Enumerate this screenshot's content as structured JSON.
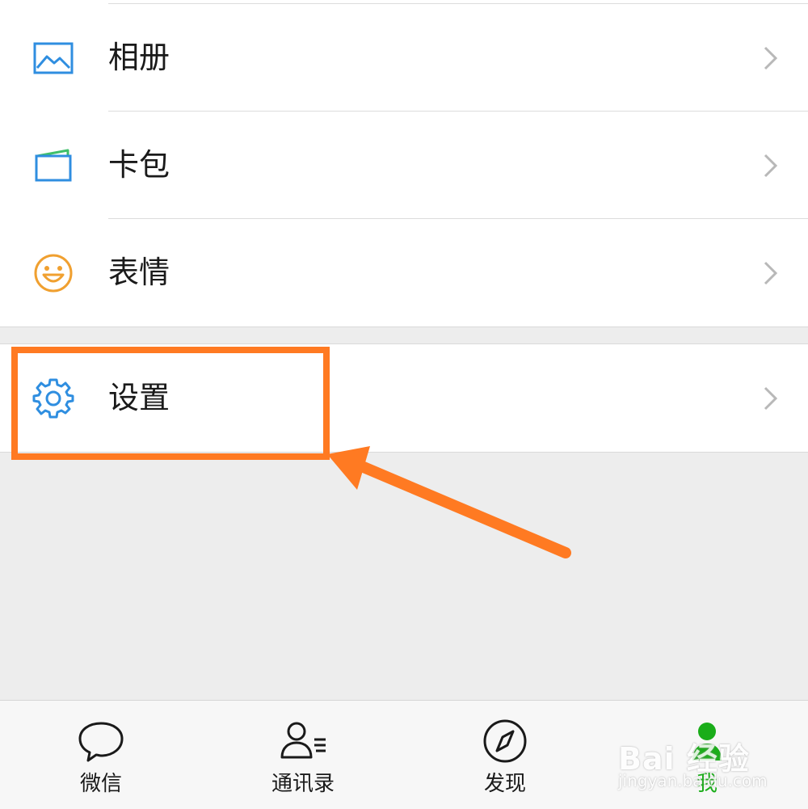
{
  "menu": {
    "items": [
      {
        "label": "相册",
        "icon": "album-icon"
      },
      {
        "label": "卡包",
        "icon": "card-wallet-icon"
      },
      {
        "label": "表情",
        "icon": "emoji-smile-icon"
      }
    ],
    "settings": {
      "label": "设置",
      "icon": "gear-icon"
    }
  },
  "tabbar": {
    "tabs": [
      {
        "label": "微信",
        "icon": "chat-bubble-icon",
        "active": false
      },
      {
        "label": "通讯录",
        "icon": "contacts-icon",
        "active": false
      },
      {
        "label": "发现",
        "icon": "compass-icon",
        "active": false
      },
      {
        "label": "我",
        "icon": "person-icon",
        "active": true
      }
    ]
  },
  "watermark": {
    "main": "Bai 经验",
    "sub": "jingyan.baidu.com"
  },
  "colors": {
    "accent_blue": "#2f8ee0",
    "emoji_orange": "#f0a030",
    "highlight_orange": "#ff7a22",
    "active_green": "#1aad19",
    "background": "#ededed"
  }
}
